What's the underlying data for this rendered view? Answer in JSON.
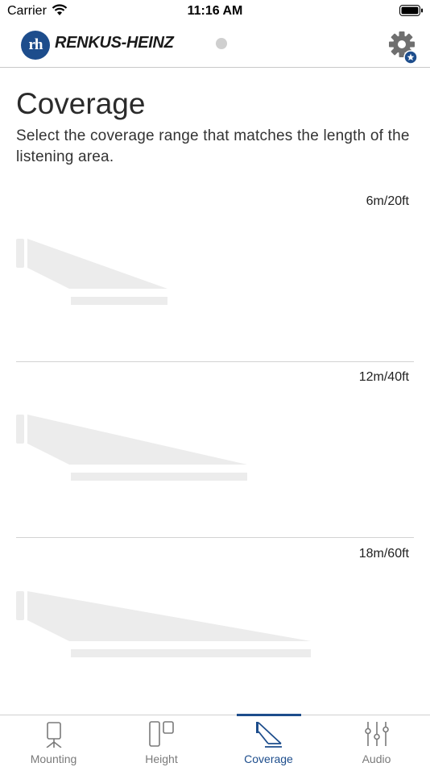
{
  "status_bar": {
    "carrier": "Carrier",
    "time": "11:16 AM"
  },
  "header": {
    "logo_mark": "rh",
    "brand": "RENKUS-HEINZ"
  },
  "page": {
    "title": "Coverage",
    "subtitle": "Select the coverage range that matches the length of the listening area."
  },
  "options": [
    {
      "label": "6m/20ft",
      "length_fraction": 0.38
    },
    {
      "label": "12m/40ft",
      "length_fraction": 0.58
    },
    {
      "label": "18m/60ft",
      "length_fraction": 0.74
    }
  ],
  "tabs": [
    {
      "label": "Mounting",
      "icon": "mounting-icon",
      "active": false
    },
    {
      "label": "Height",
      "icon": "height-icon",
      "active": false
    },
    {
      "label": "Coverage",
      "icon": "coverage-icon",
      "active": true
    },
    {
      "label": "Audio",
      "icon": "audio-icon",
      "active": false
    }
  ],
  "colors": {
    "brand": "#1d4d8c",
    "diagram": "#ececec",
    "inactive_tab": "#7a7a7a"
  }
}
